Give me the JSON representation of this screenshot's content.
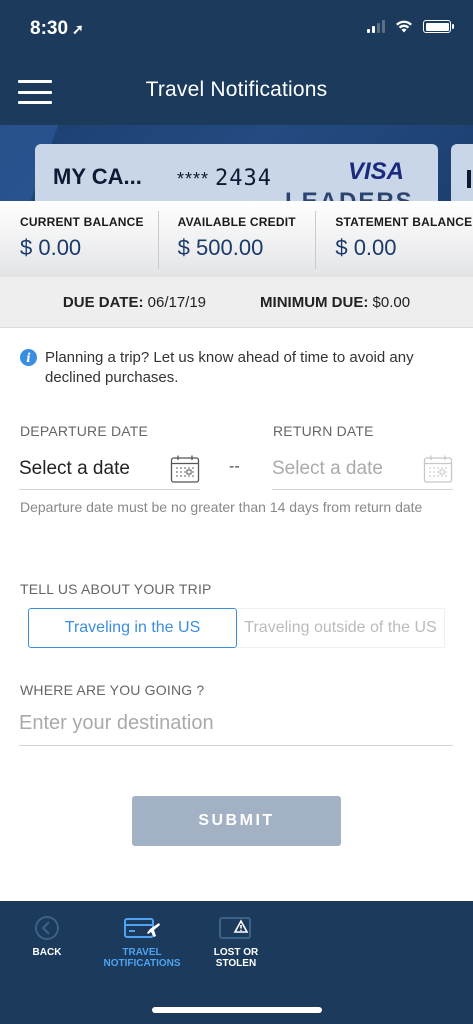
{
  "status_bar": {
    "time": "8:30"
  },
  "header": {
    "title": "Travel Notifications"
  },
  "card": {
    "name": "MY CA...",
    "masked_prefix": "****",
    "last_four": "2434",
    "brand": "VISA",
    "faint_text": "LEADERS"
  },
  "balances": [
    {
      "label": "CURRENT BALANCE",
      "value": "$ 0.00"
    },
    {
      "label": "AVAILABLE CREDIT",
      "value": "$ 500.00"
    },
    {
      "label": "STATEMENT BALANCE",
      "value": "$ 0.00"
    }
  ],
  "due": {
    "due_label": "DUE DATE:",
    "due_value": "06/17/19",
    "min_label": "MINIMUM DUE:",
    "min_value": "$0.00"
  },
  "info": {
    "text": "Planning a trip? Let us know ahead of time to avoid any declined purchases."
  },
  "dates": {
    "departure_label": "DEPARTURE DATE",
    "departure_value": "Select a date",
    "separator": "--",
    "return_label": "RETURN DATE",
    "return_value": "Select a date",
    "help": "Departure date must be no greater than 14 days from return date"
  },
  "trip": {
    "label": "TELL US ABOUT YOUR TRIP",
    "options": [
      "Traveling in the US",
      "Traveling outside of the US"
    ],
    "selected": "Traveling in the US"
  },
  "destination": {
    "label": "WHERE ARE YOU GOING ?",
    "placeholder": "Enter your destination"
  },
  "submit": {
    "label": "SUBMIT"
  },
  "bottom_nav": [
    {
      "label": "BACK",
      "icon": "back-circle-icon"
    },
    {
      "label": "TRAVEL NOTIFICATIONS",
      "icon": "card-plane-icon",
      "active": true
    },
    {
      "label": "LOST OR STOLEN",
      "icon": "card-warning-icon"
    }
  ],
  "colors": {
    "navy": "#1b3a5c",
    "accent": "#3a8ee0",
    "submit_disabled": "#a2b1c4"
  }
}
